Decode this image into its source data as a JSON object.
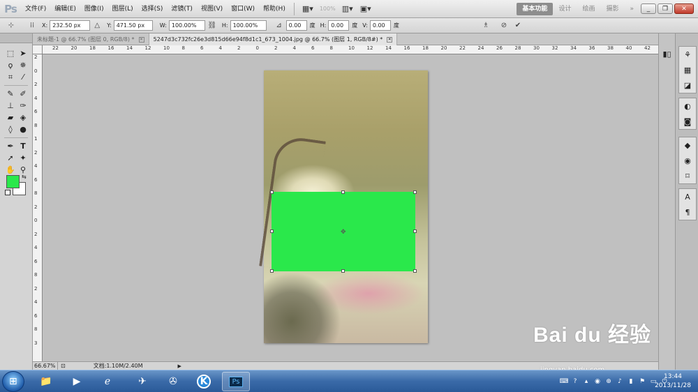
{
  "app": {
    "logo": "Ps"
  },
  "menu": [
    "文件(F)",
    "编辑(E)",
    "图像(I)",
    "图层(L)",
    "选择(S)",
    "滤镜(T)",
    "视图(V)",
    "窗口(W)",
    "帮助(H)"
  ],
  "menubar": {
    "zoom": "100%"
  },
  "workspaces": [
    "基本功能",
    "设计",
    "绘画",
    "摄影"
  ],
  "workspace_more": "»",
  "options": {
    "x_label": "X:",
    "x_value": "232.50 px",
    "y_label": "Y:",
    "y_value": "471.50 px",
    "w_label": "W:",
    "w_value": "100.00%",
    "h_label": "H:",
    "h_value": "100.00%",
    "angle_value": "0.00",
    "angle_unit": "度",
    "hskew_label": "H:",
    "hskew_value": "0.00",
    "hskew_unit": "度",
    "vskew_label": "V:",
    "vskew_value": "0.00",
    "vskew_unit": "度"
  },
  "tabs": [
    {
      "label": "未标题-1 @ 66.7% (图层 0, RGB/8) *"
    },
    {
      "label": "5247d3c732fc26e3d815d66e94f8d1c1_673_1004.jpg @ 66.7% (图层 1, RGB/8#) *"
    }
  ],
  "ruler_h": [
    "22",
    "20",
    "18",
    "16",
    "14",
    "12",
    "10",
    "8",
    "6",
    "4",
    "2",
    "0",
    "2",
    "4",
    "6",
    "8",
    "10",
    "12",
    "14",
    "16",
    "18",
    "20",
    "22",
    "24",
    "26",
    "28",
    "30",
    "32",
    "34",
    "36",
    "38",
    "40",
    "42"
  ],
  "ruler_v": [
    "2",
    "0",
    "2",
    "4",
    "6",
    "8",
    "1",
    "2",
    "4",
    "6",
    "8",
    "2",
    "0",
    "2",
    "4",
    "6",
    "8",
    "2",
    "4",
    "6",
    "8",
    "3"
  ],
  "status": {
    "zoom": "66.67%",
    "doc_size": "文档:1.10M/2.40M",
    "arrow": "▶"
  },
  "colors": {
    "foreground": "#2ae84b",
    "background": "#ffffff",
    "shape_fill": "#2ae84b"
  },
  "watermark": {
    "main": "Bai du 经验",
    "sub": "jingyan.baidu.com"
  },
  "taskbar": {
    "apps": [
      "file-explorer",
      "media-player",
      "internet-explorer",
      "bird-app",
      "film-app",
      "k-app",
      "photoshop"
    ],
    "photoshop_label": "Ps",
    "k_label": "K",
    "clock_time": "13:44",
    "clock_date": "2013/11/28"
  },
  "icons": {
    "tools": [
      "marquee-icon",
      "move-icon",
      "lasso-icon",
      "quick-select-icon",
      "crop-icon",
      "eyedropper-icon",
      "healing-icon",
      "brush-icon",
      "stamp-icon",
      "history-brush-icon",
      "eraser-icon",
      "bucket-icon",
      "blur-icon",
      "dodge-icon",
      "pen-icon",
      "type-icon",
      "path-select-icon",
      "shape-icon",
      "hand-icon",
      "zoom-icon"
    ],
    "right_panel": [
      "history-icon",
      "swatches-icon",
      "styles-icon",
      "adjustments-icon",
      "masks-icon",
      "layers-icon",
      "channels-icon",
      "paths-icon",
      "character-icon",
      "paragraph-icon"
    ]
  }
}
